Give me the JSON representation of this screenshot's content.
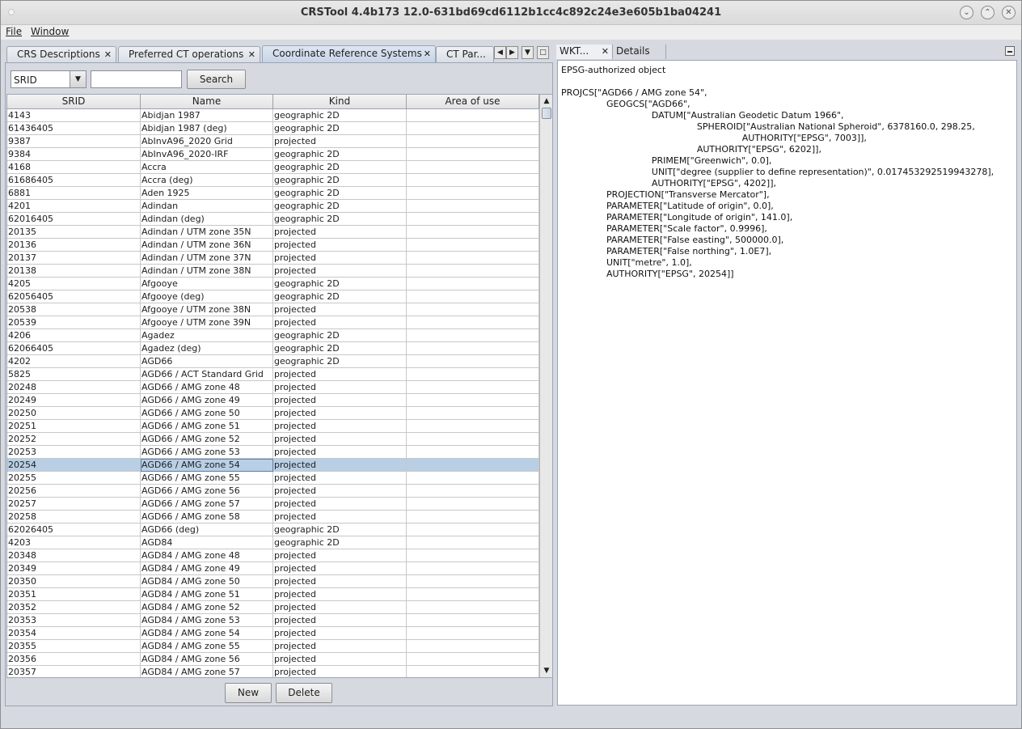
{
  "window": {
    "title": "CRSTool 4.4b173 12.0-631bd69cd6112b1cc4c892c24e3e605b1ba04241"
  },
  "menu": {
    "file_label": "File",
    "window_label": "Window"
  },
  "tabs": {
    "crs_descriptions": "CRS Descriptions",
    "preferred_ct": "Preferred CT operations",
    "coordinate_reference_systems": "Coordinate Reference Systems",
    "ct_par": "CT Par..."
  },
  "search": {
    "field_selected": "SRID",
    "query_value": "",
    "button_label": "Search"
  },
  "table": {
    "columns": [
      "SRID",
      "Name",
      "Kind",
      "Area of use"
    ],
    "selected_srid": "20254",
    "rows": [
      [
        "4143",
        "Abidjan 1987",
        "geographic 2D",
        ""
      ],
      [
        "61436405",
        "Abidjan 1987 (deg)",
        "geographic 2D",
        ""
      ],
      [
        "9387",
        "AbInvA96_2020 Grid",
        "projected",
        ""
      ],
      [
        "9384",
        "AbInvA96_2020-IRF",
        "geographic 2D",
        ""
      ],
      [
        "4168",
        "Accra",
        "geographic 2D",
        ""
      ],
      [
        "61686405",
        "Accra (deg)",
        "geographic 2D",
        ""
      ],
      [
        "6881",
        "Aden 1925",
        "geographic 2D",
        ""
      ],
      [
        "4201",
        "Adindan",
        "geographic 2D",
        ""
      ],
      [
        "62016405",
        "Adindan (deg)",
        "geographic 2D",
        ""
      ],
      [
        "20135",
        "Adindan / UTM zone 35N",
        "projected",
        ""
      ],
      [
        "20136",
        "Adindan / UTM zone 36N",
        "projected",
        ""
      ],
      [
        "20137",
        "Adindan / UTM zone 37N",
        "projected",
        ""
      ],
      [
        "20138",
        "Adindan / UTM zone 38N",
        "projected",
        ""
      ],
      [
        "4205",
        "Afgooye",
        "geographic 2D",
        ""
      ],
      [
        "62056405",
        "Afgooye (deg)",
        "geographic 2D",
        ""
      ],
      [
        "20538",
        "Afgooye / UTM zone 38N",
        "projected",
        ""
      ],
      [
        "20539",
        "Afgooye / UTM zone 39N",
        "projected",
        ""
      ],
      [
        "4206",
        "Agadez",
        "geographic 2D",
        ""
      ],
      [
        "62066405",
        "Agadez (deg)",
        "geographic 2D",
        ""
      ],
      [
        "4202",
        "AGD66",
        "geographic 2D",
        ""
      ],
      [
        "5825",
        "AGD66 / ACT Standard Grid",
        "projected",
        ""
      ],
      [
        "20248",
        "AGD66 / AMG zone 48",
        "projected",
        ""
      ],
      [
        "20249",
        "AGD66 / AMG zone 49",
        "projected",
        ""
      ],
      [
        "20250",
        "AGD66 / AMG zone 50",
        "projected",
        ""
      ],
      [
        "20251",
        "AGD66 / AMG zone 51",
        "projected",
        ""
      ],
      [
        "20252",
        "AGD66 / AMG zone 52",
        "projected",
        ""
      ],
      [
        "20253",
        "AGD66 / AMG zone 53",
        "projected",
        ""
      ],
      [
        "20254",
        "AGD66 / AMG zone 54",
        "projected",
        ""
      ],
      [
        "20255",
        "AGD66 / AMG zone 55",
        "projected",
        ""
      ],
      [
        "20256",
        "AGD66 / AMG zone 56",
        "projected",
        ""
      ],
      [
        "20257",
        "AGD66 / AMG zone 57",
        "projected",
        ""
      ],
      [
        "20258",
        "AGD66 / AMG zone 58",
        "projected",
        ""
      ],
      [
        "62026405",
        "AGD66 (deg)",
        "geographic 2D",
        ""
      ],
      [
        "4203",
        "AGD84",
        "geographic 2D",
        ""
      ],
      [
        "20348",
        "AGD84 / AMG zone 48",
        "projected",
        ""
      ],
      [
        "20349",
        "AGD84 / AMG zone 49",
        "projected",
        ""
      ],
      [
        "20350",
        "AGD84 / AMG zone 50",
        "projected",
        ""
      ],
      [
        "20351",
        "AGD84 / AMG zone 51",
        "projected",
        ""
      ],
      [
        "20352",
        "AGD84 / AMG zone 52",
        "projected",
        ""
      ],
      [
        "20353",
        "AGD84 / AMG zone 53",
        "projected",
        ""
      ],
      [
        "20354",
        "AGD84 / AMG zone 54",
        "projected",
        ""
      ],
      [
        "20355",
        "AGD84 / AMG zone 55",
        "projected",
        ""
      ],
      [
        "20356",
        "AGD84 / AMG zone 56",
        "projected",
        ""
      ],
      [
        "20357",
        "AGD84 / AMG zone 57",
        "projected",
        ""
      ]
    ]
  },
  "buttons": {
    "new_label": "New",
    "delete_label": "Delete"
  },
  "right_panel": {
    "tab_wkt": "WKT...",
    "tab_details": "Details",
    "header": "EPSG-authorized object",
    "wkt_text": "PROJCS[\"AGD66 / AMG zone 54\",\n                GEOGCS[\"AGD66\",\n                                DATUM[\"Australian Geodetic Datum 1966\",\n                                                SPHEROID[\"Australian National Spheroid\", 6378160.0, 298.25,\n                                                                AUTHORITY[\"EPSG\", 7003]],\n                                                AUTHORITY[\"EPSG\", 6202]],\n                                PRIMEM[\"Greenwich\", 0.0],\n                                UNIT[\"degree (supplier to define representation)\", 0.017453292519943278],\n                                AUTHORITY[\"EPSG\", 4202]],\n                PROJECTION[\"Transverse Mercator\"],\n                PARAMETER[\"Latitude of origin\", 0.0],\n                PARAMETER[\"Longitude of origin\", 141.0],\n                PARAMETER[\"Scale factor\", 0.9996],\n                PARAMETER[\"False easting\", 500000.0],\n                PARAMETER[\"False northing\", 1.0E7],\n                UNIT[\"metre\", 1.0],\n                AUTHORITY[\"EPSG\", 20254]]"
  },
  "colors": {
    "selection": "#b8cfe5",
    "window_bg": "#d6d9df"
  }
}
